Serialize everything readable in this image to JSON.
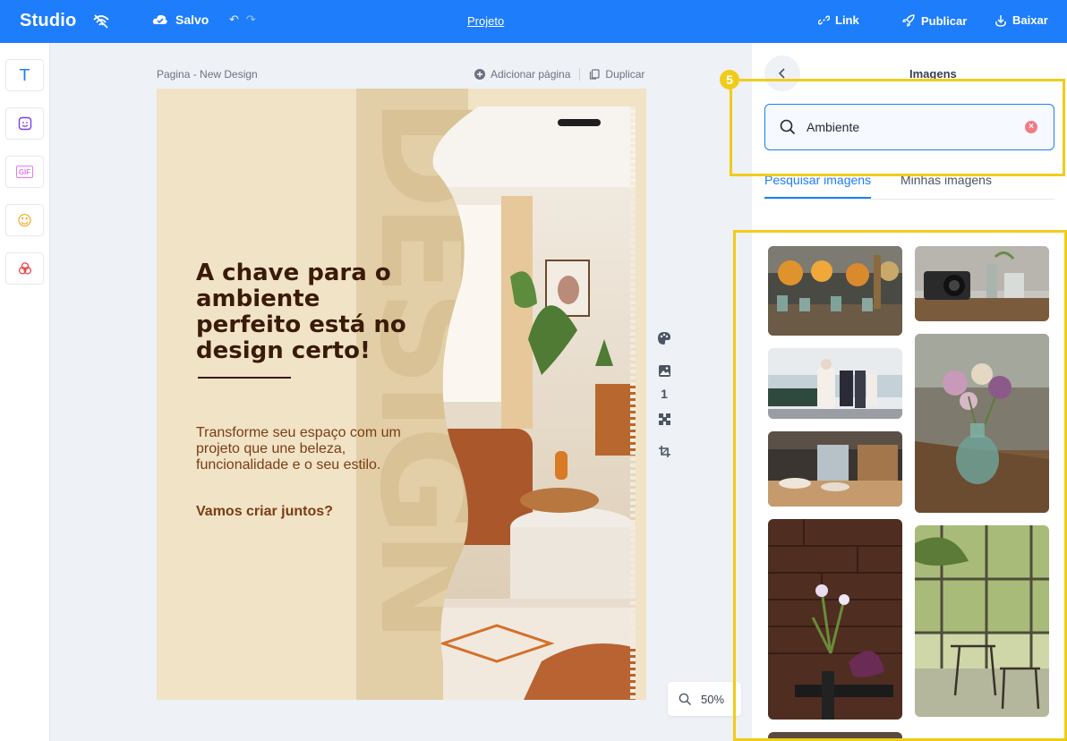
{
  "topbar": {
    "logo": "Studio",
    "saved_label": "Salvo",
    "undo_glyph": "↶",
    "redo_glyph": "↷",
    "project_label": "Projeto",
    "link_label": "Link",
    "publish_label": "Publicar",
    "download_label": "Baixar"
  },
  "rail": {
    "items": [
      {
        "name": "text-tool",
        "icon": "text-icon",
        "glyph": "T",
        "color": "#1e7dfa"
      },
      {
        "name": "sticker-tool",
        "icon": "sticker-icon",
        "color": "#7c3aed"
      },
      {
        "name": "gif-tool",
        "icon": "gif-icon",
        "glyph": "GIF",
        "color": "#e879f9"
      },
      {
        "name": "emoji-tool",
        "icon": "emoji-icon",
        "glyph": "☺",
        "color": "#f59e0b"
      },
      {
        "name": "shapes-tool",
        "icon": "shapes-icon",
        "color": "#ef4444"
      }
    ]
  },
  "canvas": {
    "page_label": "Pagina - New Design",
    "add_page_label": "Adicionar página",
    "duplicate_label": "Duplicar",
    "page_number": "1",
    "zoom": "50%"
  },
  "design": {
    "watermark": "DESIGN",
    "headline": "A chave para o ambiente perfeito está no design certo!",
    "body": "Transforme seu espaço com um projeto que une beleza, funcionalidade e o seu estilo.",
    "cta": "Vamos criar juntos?"
  },
  "panel": {
    "title": "Imagens",
    "search_value": "Ambiente",
    "tabs": [
      "Pesquisar imagens",
      "Minhas imagens"
    ],
    "active_tab": 0
  },
  "annotation": {
    "badge": "5",
    "color": "#f0cc1a"
  },
  "colors": {
    "brand": "#1e7dfa",
    "canvas_bg": "#f1e3c6",
    "headline": "#3a1a08",
    "body_text": "#7a3d14"
  }
}
